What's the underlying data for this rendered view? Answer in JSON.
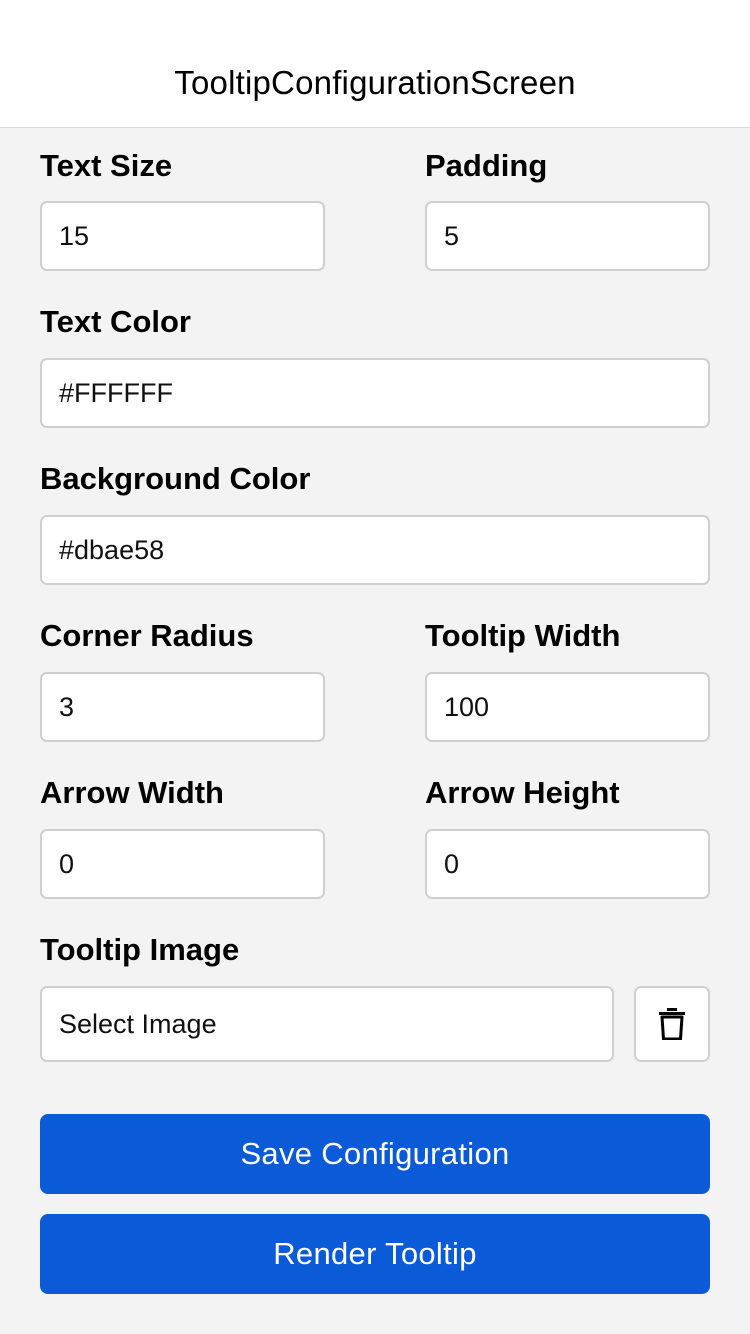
{
  "header": {
    "title": "TooltipConfigurationScreen"
  },
  "form": {
    "text_size": {
      "label": "Text Size",
      "value": "15"
    },
    "padding": {
      "label": "Padding",
      "value": "5"
    },
    "text_color": {
      "label": "Text Color",
      "value": "#FFFFFF"
    },
    "background_color": {
      "label": "Background Color",
      "value": "#dbae58"
    },
    "corner_radius": {
      "label": "Corner Radius",
      "value": "3"
    },
    "tooltip_width": {
      "label": "Tooltip Width",
      "value": "100"
    },
    "arrow_width": {
      "label": "Arrow Width",
      "value": "0"
    },
    "arrow_height": {
      "label": "Arrow Height",
      "value": "0"
    },
    "tooltip_image": {
      "label": "Tooltip Image",
      "button_label": "Select Image"
    }
  },
  "actions": {
    "save_label": "Save Configuration",
    "render_label": "Render Tooltip"
  },
  "icons": {
    "delete_image": "trash-icon"
  },
  "colors": {
    "primary": "#0b5bd8",
    "background": "#f3f3f3"
  }
}
